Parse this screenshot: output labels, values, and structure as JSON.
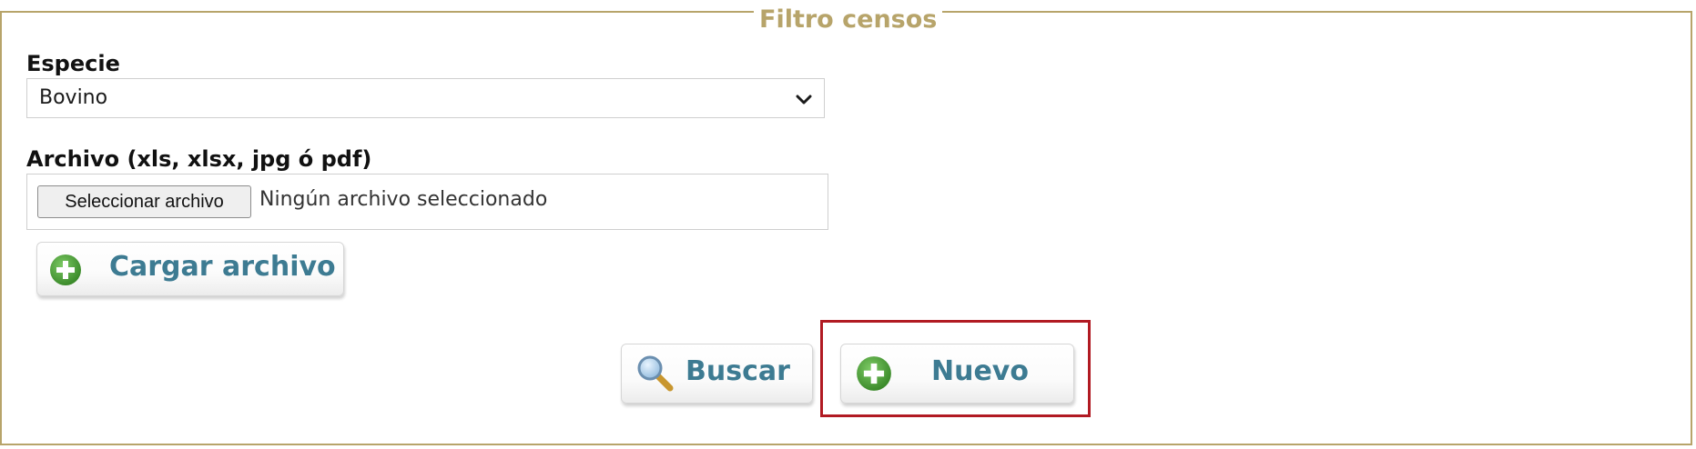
{
  "fieldset": {
    "legend": "Filtro censos"
  },
  "species": {
    "label": "Especie",
    "selected": "Bovino"
  },
  "file": {
    "label": "Archivo (xls, xlsx, jpg ó pdf)",
    "choose_button": "Seleccionar archivo",
    "status": "Ningún archivo seleccionado"
  },
  "actions": {
    "upload_label": "Cargar archivo",
    "search_label": "Buscar",
    "new_label": "Nuevo"
  },
  "icons": {
    "plus_icon": "plus-circle",
    "search_icon": "magnifier",
    "chevron": "chevron-down"
  },
  "colors": {
    "border": "#b7a46a",
    "legend": "#b7a46a",
    "button_text": "#3d7b92",
    "plus_green": "#4fa23a",
    "highlight": "#b11a22"
  }
}
